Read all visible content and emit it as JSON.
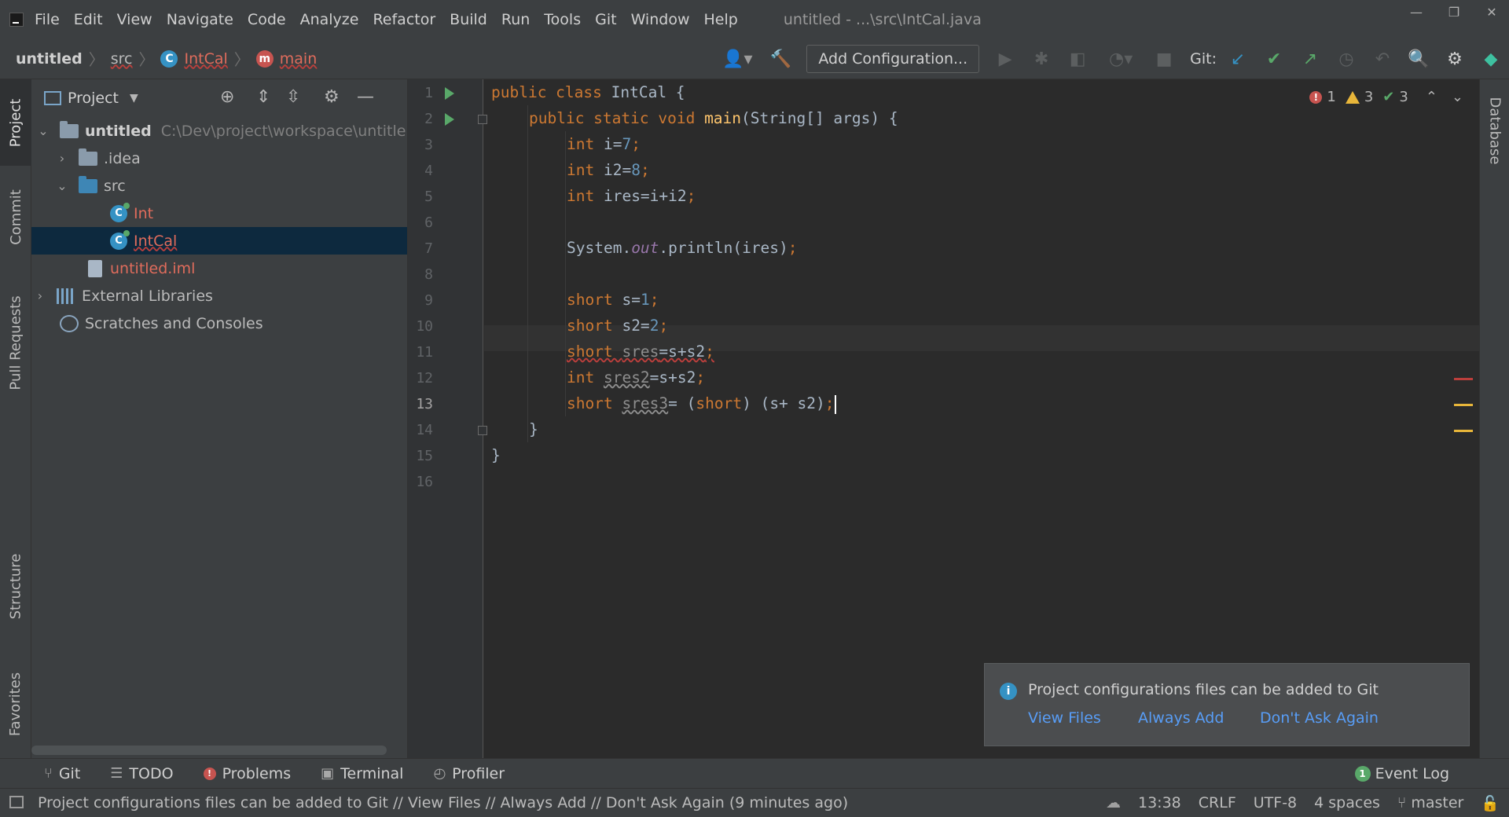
{
  "window": {
    "title": "untitled - ...\\src\\IntCal.java",
    "menu": [
      "File",
      "Edit",
      "View",
      "Navigate",
      "Code",
      "Analyze",
      "Refactor",
      "Build",
      "Run",
      "Tools",
      "Git",
      "Window",
      "Help"
    ],
    "controls": {
      "minimize": "—",
      "maximize": "❐",
      "close": "✕"
    }
  },
  "breadcrumb": {
    "project": "untitled",
    "folder": "src",
    "class_badge": "C",
    "class": "IntCal",
    "method_badge": "m",
    "method": "main"
  },
  "toolbar": {
    "add_config": "Add Configuration...",
    "git_label": "Git:",
    "icons": [
      "user-icon",
      "build-hammer-icon",
      "run-icon",
      "debug-icon",
      "coverage-icon",
      "profile-icon",
      "stop-icon",
      "git-update-icon",
      "git-commit-icon",
      "git-push-icon",
      "history-icon",
      "rollback-icon",
      "search-icon",
      "settings-icon",
      "toolbox-icon"
    ]
  },
  "tool_windows": {
    "left": [
      "Project",
      "Commit",
      "Pull Requests",
      "Structure",
      "Favorites"
    ],
    "right": [
      "Database"
    ]
  },
  "project_panel": {
    "title": "Project",
    "tree": [
      {
        "label": "untitled",
        "path": "C:\\Dev\\project\\workspace\\untitle"
      },
      {
        "label": ".idea"
      },
      {
        "label": "src"
      },
      {
        "label": "Int"
      },
      {
        "label": "IntCal"
      },
      {
        "label": "untitled.iml"
      },
      {
        "label": "External Libraries"
      },
      {
        "label": "Scratches and Consoles"
      }
    ],
    "class_badge": "C"
  },
  "editor": {
    "line_numbers": [
      "1",
      "2",
      "3",
      "4",
      "5",
      "6",
      "7",
      "8",
      "9",
      "10",
      "11",
      "12",
      "13",
      "14",
      "15",
      "16"
    ],
    "current_line": "13",
    "code": {
      "l1": {
        "kw": "public class ",
        "name": "IntCal {"
      },
      "l2": {
        "kw": "public static void ",
        "fn": "main",
        "rest": "(String[] args) {"
      },
      "l3": {
        "kw": "int ",
        "var": "i=",
        "num": "7",
        "semi": ";"
      },
      "l4": {
        "kw": "int ",
        "var": "i2=",
        "num": "8",
        "semi": ";"
      },
      "l5": {
        "kw": "int ",
        "var": "ires=i+i2",
        "semi": ";"
      },
      "l7": {
        "obj": "System.",
        "fld": "out",
        "call": ".println(ires)",
        "semi": ";"
      },
      "l9": {
        "kw": "short ",
        "var": "s=",
        "num": "1",
        "semi": ";"
      },
      "l10": {
        "kw": "short ",
        "var": "s2=",
        "num": "2",
        "semi": ";"
      },
      "l11": {
        "kw": "short ",
        "var": "sres",
        "expr": "=s+s2",
        "semi": ";"
      },
      "l12": {
        "kw": "int ",
        "var": "sres2",
        "expr": "=s+s2",
        "semi": ";"
      },
      "l13": {
        "kw": "short ",
        "var": "sres3",
        "eq": "= (",
        "cast": "short",
        "expr": ") (s+ s2)",
        "semi": ";"
      },
      "l14": "}",
      "l15": "}"
    },
    "inspections": {
      "errors": "1",
      "warnings": "3",
      "weak_warnings": "3",
      "err_glyph": "!",
      "ok_glyph": "✔",
      "up": "⌃",
      "down": "⌄"
    }
  },
  "notification": {
    "message": "Project configurations files can be added to Git",
    "actions": [
      "View Files",
      "Always Add",
      "Don't Ask Again"
    ],
    "icon_glyph": "i"
  },
  "bottom_tabs": [
    "Git",
    "TODO",
    "Problems",
    "Terminal",
    "Profiler"
  ],
  "event_log": {
    "label": "Event Log",
    "count": "1"
  },
  "statusbar": {
    "message": "Project configurations files can be added to Git // View Files // Always Add // Don't Ask Again (9 minutes ago)",
    "position": "13:38",
    "line_sep": "CRLF",
    "encoding": "UTF-8",
    "indent": "4 spaces",
    "branch": "master"
  },
  "colors": {
    "background": "#2b2b2b",
    "panel": "#3c3f41",
    "keyword": "#cc7832",
    "number": "#6897bb",
    "field": "#9876aa",
    "function": "#ffc66d",
    "error": "#c75450",
    "warning": "#e8b63a",
    "link": "#589df6",
    "selection": "#0d293e"
  }
}
